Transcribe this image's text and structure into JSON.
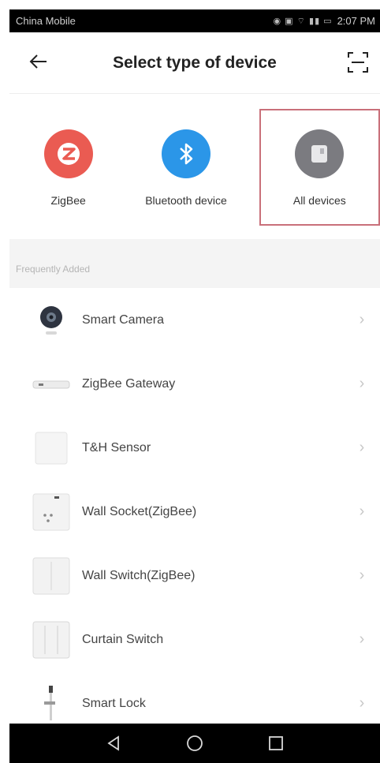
{
  "status_bar": {
    "carrier": "China Mobile",
    "time": "2:07 PM"
  },
  "header": {
    "title": "Select type of device"
  },
  "categories": [
    {
      "label": "ZigBee",
      "icon": "zigbee-icon",
      "color": "#ea5b52"
    },
    {
      "label": "Bluetooth device",
      "icon": "bluetooth-icon",
      "color": "#2b96e8"
    },
    {
      "label": "All devices",
      "icon": "all-devices-icon",
      "color": "#7b7b80"
    }
  ],
  "section": {
    "title": "Frequently Added"
  },
  "devices": [
    {
      "label": "Smart Camera",
      "icon": "camera-icon"
    },
    {
      "label": "ZigBee Gateway",
      "icon": "gateway-icon"
    },
    {
      "label": "T&H Sensor",
      "icon": "sensor-icon"
    },
    {
      "label": "Wall Socket(ZigBee)",
      "icon": "socket-icon"
    },
    {
      "label": "Wall Switch(ZigBee)",
      "icon": "switch-icon"
    },
    {
      "label": "Curtain Switch",
      "icon": "curtain-switch-icon"
    },
    {
      "label": "Smart Lock",
      "icon": "lock-icon"
    }
  ],
  "colors": {
    "highlight_border": "#c9707a",
    "nav_bar": "#000000"
  }
}
